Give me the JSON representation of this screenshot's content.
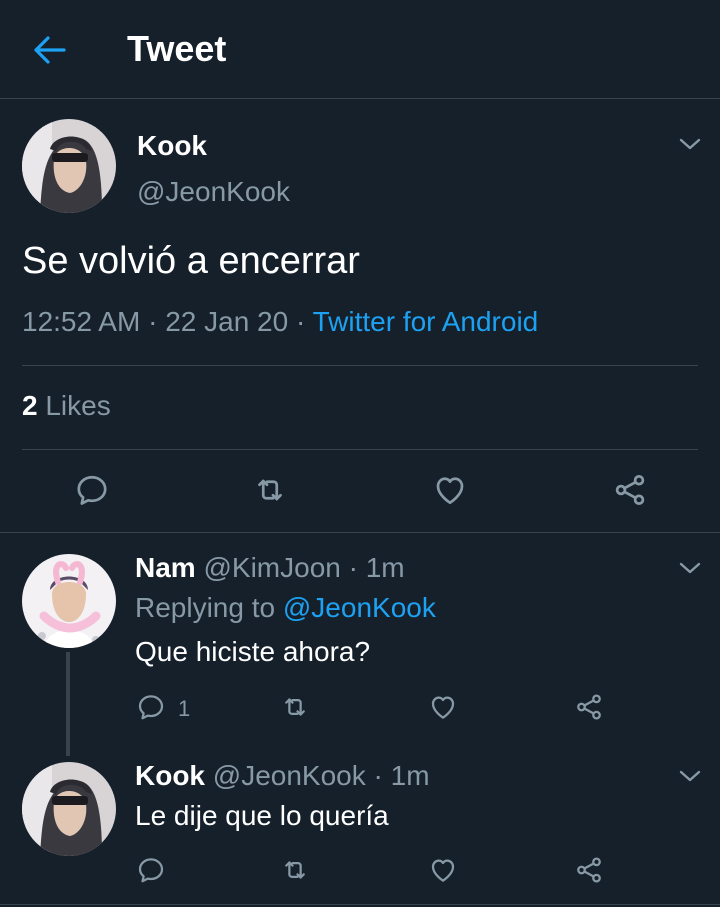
{
  "header": {
    "title": "Tweet"
  },
  "tweet": {
    "name": "Kook",
    "handle": "@JeonKook",
    "text": "Se volvió a encerrar",
    "time": "12:52 AM",
    "sep1": " · ",
    "date": "22 Jan 20",
    "sep2": " · ",
    "source": "Twitter for Android",
    "likes_count": "2",
    "likes_label": " Likes"
  },
  "replies": [
    {
      "name": "Nam",
      "handle": " @KimJoon · 1m",
      "replying_prefix": "Replying to ",
      "replying_to": "@JeonKook",
      "text": "Que hiciste ahora?",
      "reply_count": "1"
    },
    {
      "name": "Kook",
      "handle": " @JeonKook · 1m",
      "text": "Le dije que lo quería"
    }
  ],
  "colors": {
    "background": "#15202b",
    "accent": "#1da1f2",
    "secondary": "#8899a6",
    "divider": "#38444d"
  },
  "icons": [
    "back-arrow-icon",
    "chevron-down-icon",
    "reply-icon",
    "retweet-icon",
    "like-icon",
    "share-icon"
  ]
}
